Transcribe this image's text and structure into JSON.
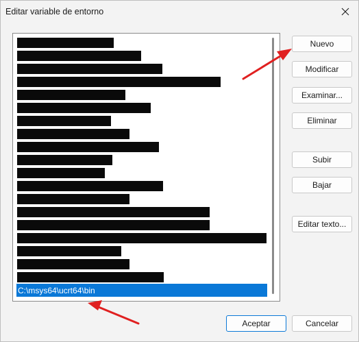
{
  "window": {
    "title": "Editar variable de entorno",
    "close_icon": "close-icon"
  },
  "list": {
    "redacted_entry_count": 19,
    "selected_entry": "C:\\msys64\\ucrt64\\bin",
    "selection_color": "#0a78d7"
  },
  "buttons": {
    "nuevo": "Nuevo",
    "modificar": "Modificar",
    "examinar": "Examinar...",
    "eliminar": "Eliminar",
    "subir": "Subir",
    "bajar": "Bajar",
    "editar_texto": "Editar texto...",
    "aceptar": "Aceptar",
    "cancelar": "Cancelar"
  },
  "annotations": {
    "arrow_color": "#e02020"
  }
}
